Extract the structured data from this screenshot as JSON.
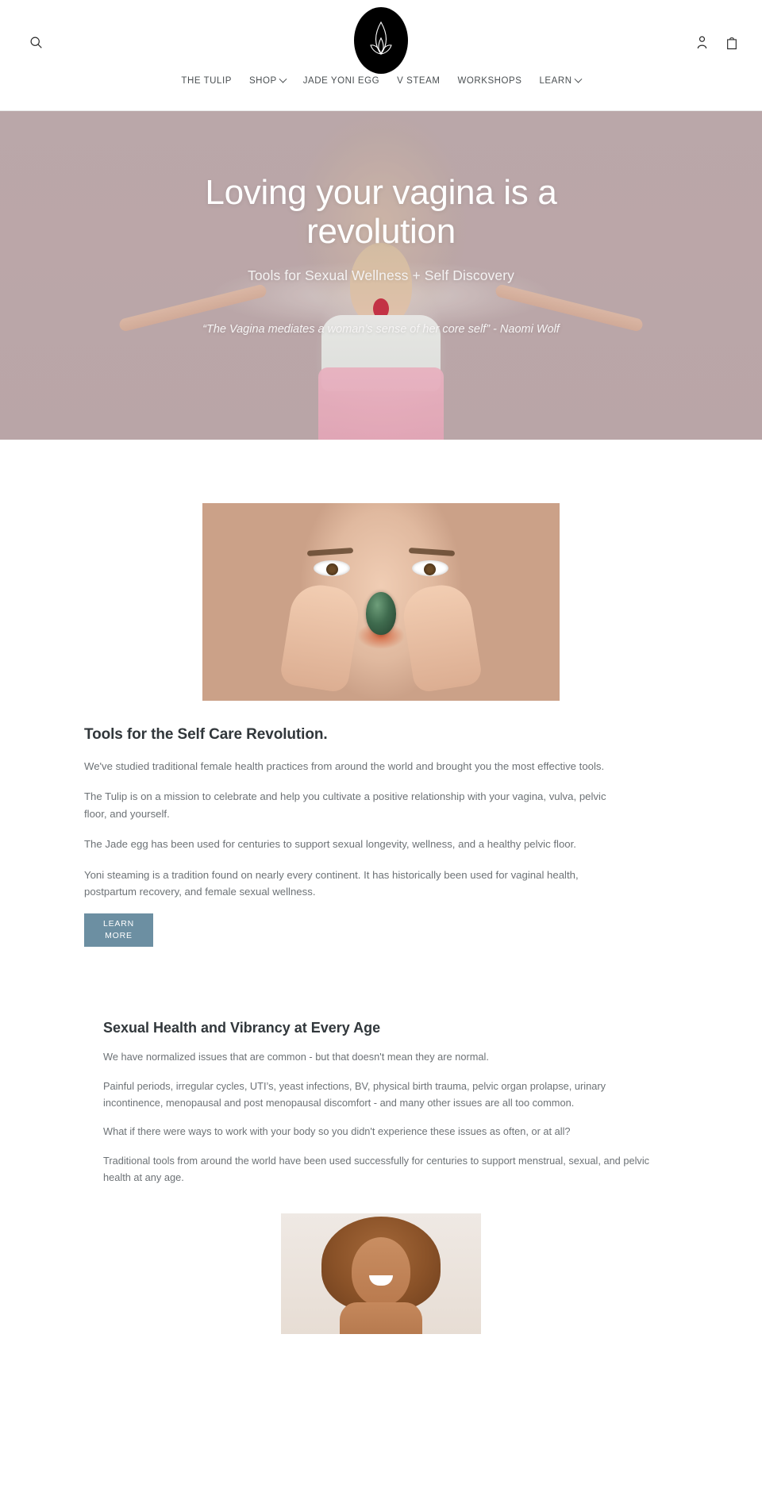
{
  "header": {
    "search_icon": "search-icon",
    "logo_alt": "the-tulip-logo",
    "account_icon": "account-icon",
    "cart_icon": "cart-icon",
    "nav": [
      {
        "label": "THE TULIP",
        "has_dropdown": false
      },
      {
        "label": "SHOP",
        "has_dropdown": true
      },
      {
        "label": "JADE YONI EGG",
        "has_dropdown": false
      },
      {
        "label": "V STEAM",
        "has_dropdown": false
      },
      {
        "label": "WORKSHOPS",
        "has_dropdown": false
      },
      {
        "label": "LEARN",
        "has_dropdown": true
      }
    ]
  },
  "hero": {
    "title": "Loving your vagina is a revolution",
    "subtitle": "Tools for Sexual Wellness + Self Discovery",
    "quote": "“The Vagina mediates a woman’s sense of her core self” -  Naomi Wolf",
    "background_color": "#bcaaac"
  },
  "section_one": {
    "image_alt": "woman-holding-jade-egg",
    "heading": "Tools for the Self Care Revolution.",
    "paragraphs": [
      "We've studied traditional female health practices from around the world and brought you the most effective tools.",
      "The Tulip is on a mission to celebrate and help you cultivate a positive relationship with your vagina, vulva, pelvic floor, and yourself.",
      "The Jade egg has been used for centuries to support sexual longevity, wellness, and a healthy pelvic floor.",
      "Yoni steaming is a tradition found on nearly every continent. It has historically been used for vaginal health, postpartum recovery, and female sexual wellness."
    ],
    "button": {
      "line1": "LEARN",
      "line2": "MORE",
      "color": "#6c8fa2"
    }
  },
  "section_two": {
    "heading": "Sexual Health and Vibrancy at Every Age",
    "paragraphs": [
      "We have normalized issues that are common - but that doesn't mean they are normal.",
      "Painful periods, irregular cycles, UTI’s, yeast infections, BV, physical birth trauma, pelvic organ prolapse, urinary incontinence, menopausal and post menopausal discomfort - and many other issues are all too common.",
      "What if there were ways to work with your body so you didn't experience these issues as often, or at all?",
      " Traditional tools from around the world have been used successfully for centuries to support menstrual, sexual, and pelvic health at any age."
    ],
    "image_alt": "smiling-woman-portrait"
  },
  "colors": {
    "text_dark": "#31373b",
    "text_body": "#6d7276",
    "accent": "#6c8fa2",
    "hero_bg": "#bcaaac"
  }
}
